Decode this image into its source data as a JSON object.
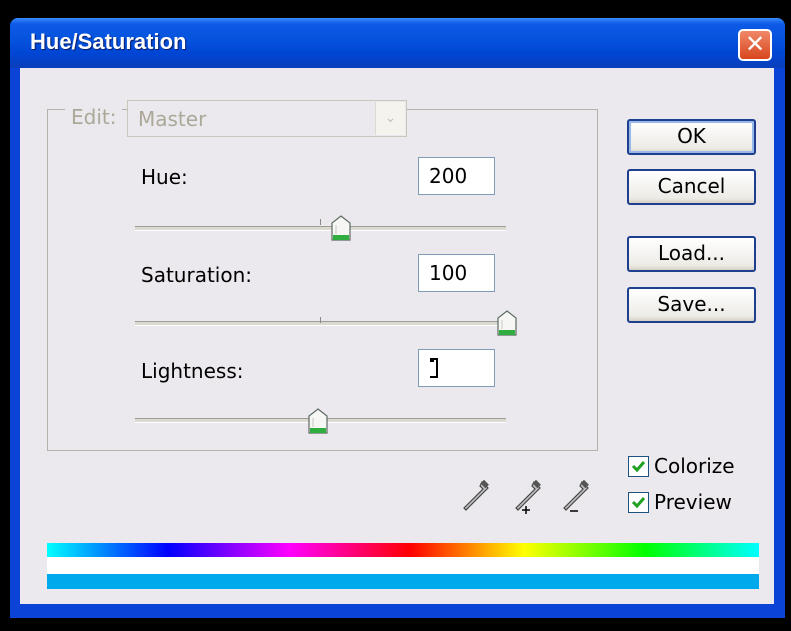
{
  "window": {
    "title": "Hue/Saturation",
    "close_symbol": "✕"
  },
  "edit": {
    "label": "Edit:",
    "value": "Master",
    "enabled": false
  },
  "sliders": {
    "hue": {
      "label": "Hue:",
      "value": "200",
      "min": -180,
      "max": 180,
      "level": 200
    },
    "saturation": {
      "label": "Saturation:",
      "value": "100",
      "min": 0,
      "max": 100,
      "level": 100
    },
    "lightness": {
      "label": "Lightness:",
      "value": "",
      "min": -100,
      "max": 100,
      "level": 0
    }
  },
  "buttons": {
    "ok": "OK",
    "cancel": "Cancel",
    "load": "Load...",
    "save": "Save..."
  },
  "options": {
    "colorize": {
      "label": "Colorize",
      "checked": true
    },
    "preview": {
      "label": "Preview",
      "checked": true
    }
  },
  "tools": [
    "eyedropper-icon",
    "eyedropper-plus-icon",
    "eyedropper-minus-icon"
  ],
  "colors": {
    "title_bar": "#0552dd",
    "dialog_bg": "#ebe9ed",
    "result_bar": "#00a8ec",
    "check_mark": "#21a121"
  }
}
